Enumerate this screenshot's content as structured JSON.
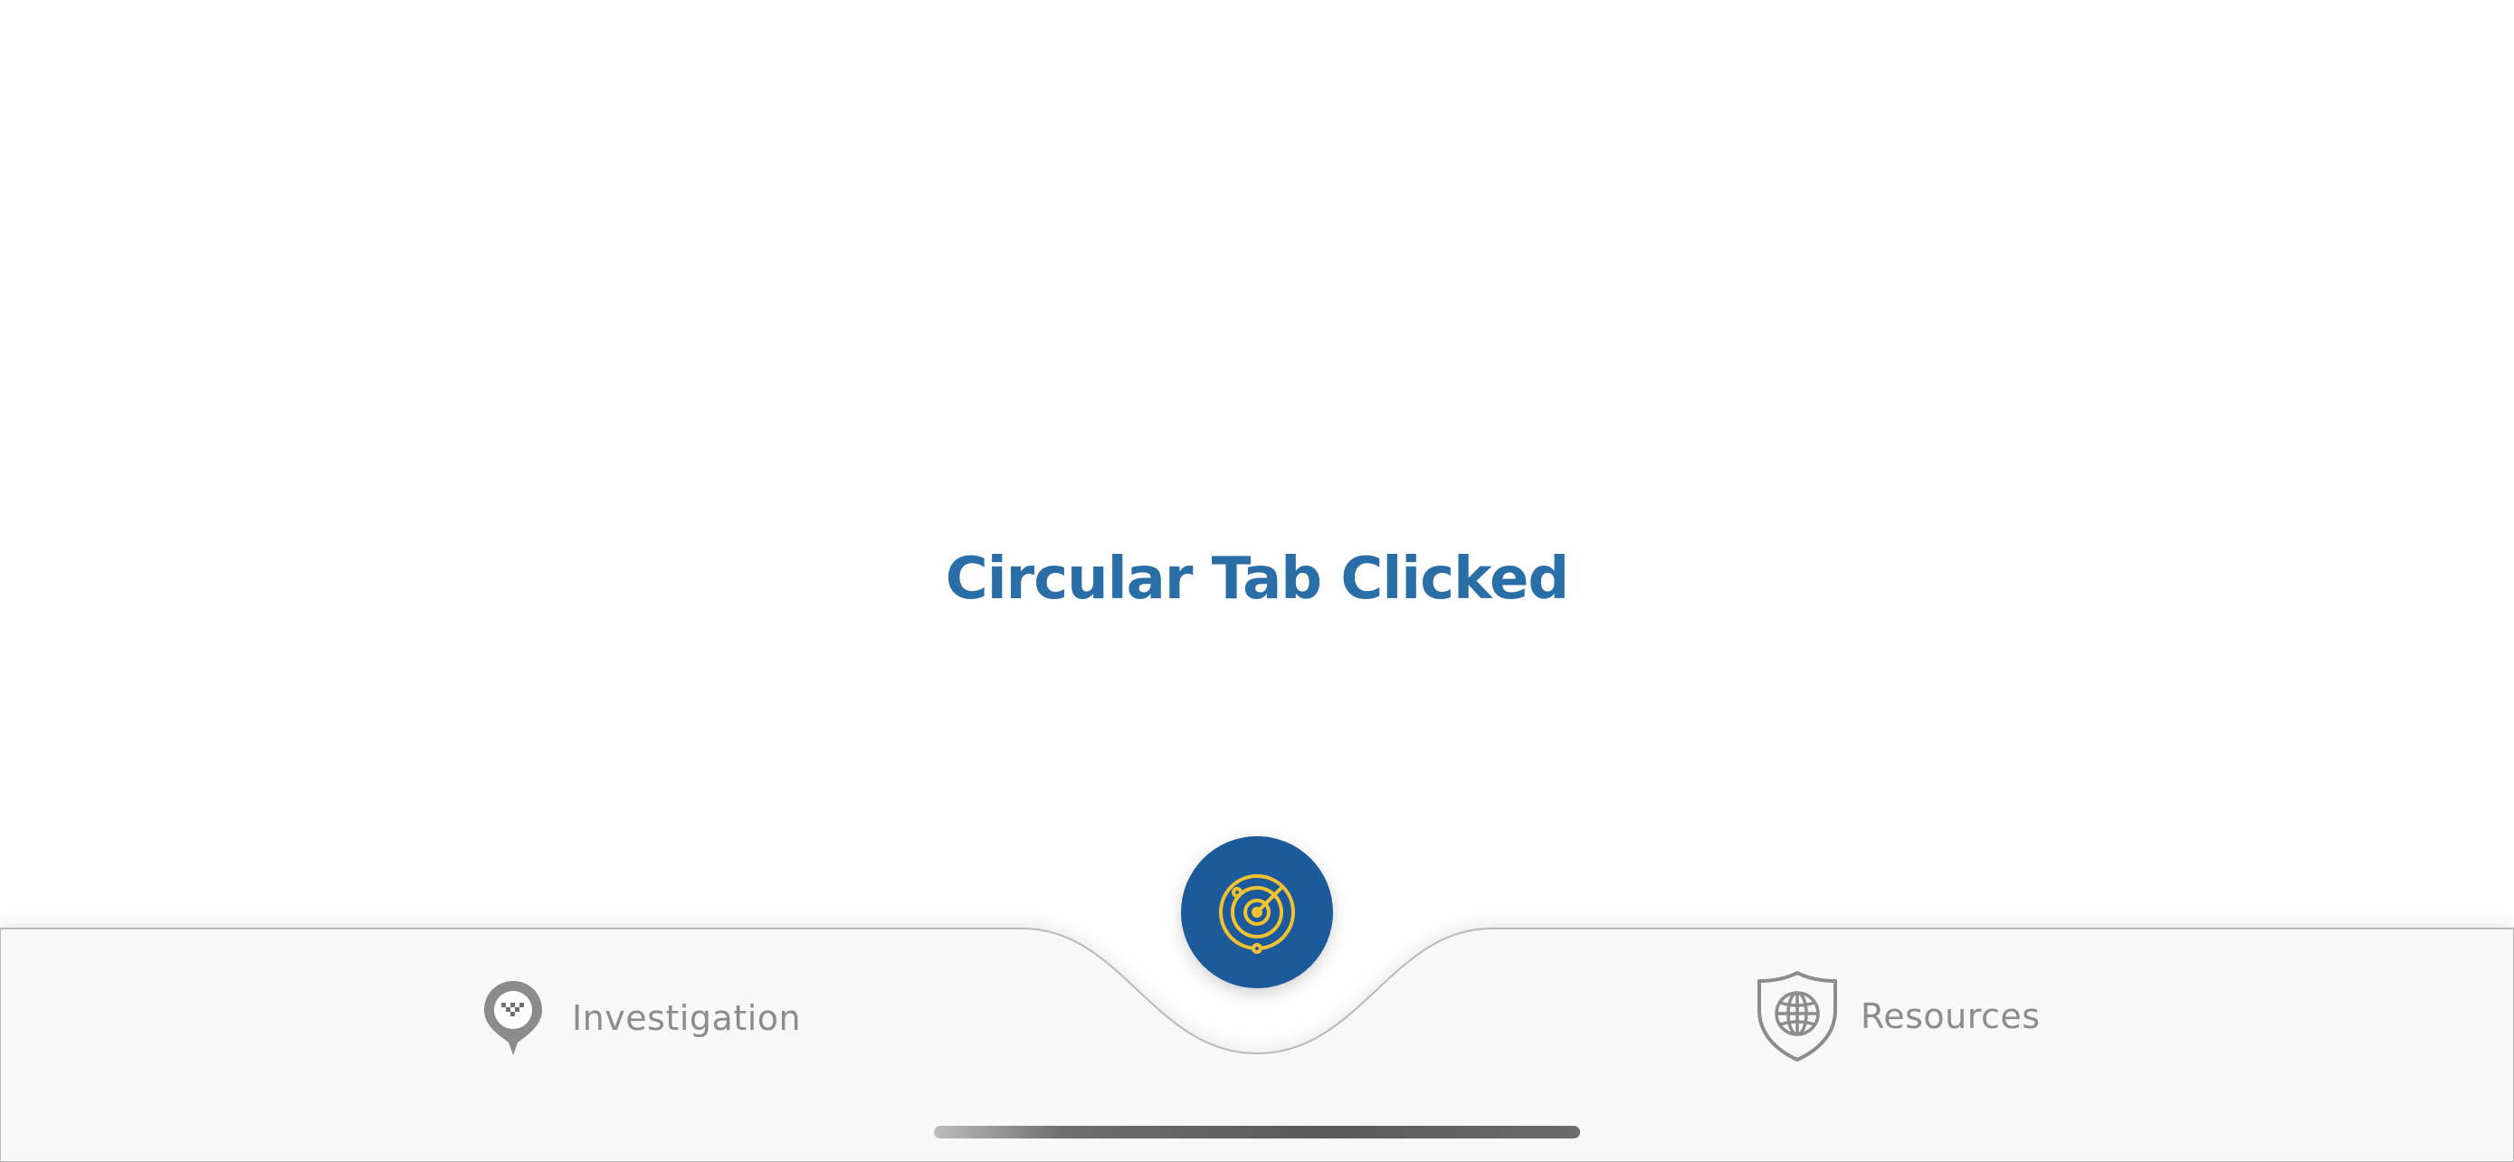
{
  "main": {
    "title": "Circular Tab Clicked"
  },
  "tabbar": {
    "center_tab": {
      "icon": "radar-icon",
      "active": true
    },
    "tabs": [
      {
        "label": "Investigation",
        "icon": "map-pin-icon"
      },
      {
        "label": "Resources",
        "icon": "shield-globe-icon"
      }
    ]
  },
  "colors": {
    "title": "#2a6ea8",
    "center_tab_bg": "#1d5a9b",
    "center_tab_icon": "#f2c230",
    "tab_inactive": "#8c8c8c",
    "tabbar_bg": "#f8f8f8"
  }
}
